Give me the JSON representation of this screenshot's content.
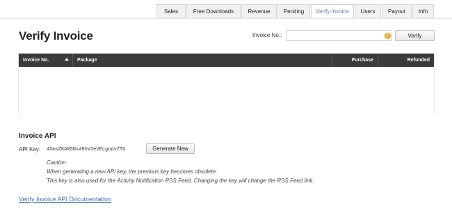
{
  "tabs": [
    {
      "label": "Sales",
      "active": false
    },
    {
      "label": "Free Downloads",
      "active": false
    },
    {
      "label": "Revenue",
      "active": false
    },
    {
      "label": "Pending",
      "active": false
    },
    {
      "label": "Verify Invoice",
      "active": true
    },
    {
      "label": "Users",
      "active": false
    },
    {
      "label": "Payout",
      "active": false
    },
    {
      "label": "Info",
      "active": false
    }
  ],
  "page": {
    "title": "Verify Invoice",
    "invoice_label": "Invoice No.:",
    "invoice_value": "",
    "info_icon": "info-icon",
    "verify_label": "Verify"
  },
  "table": {
    "columns": [
      "Invoice No.",
      "Package",
      "Purchase",
      "Refunded"
    ],
    "sort_icon": "sort-ascending-icon",
    "rows": []
  },
  "api": {
    "heading": "Invoice API",
    "key_label": "API Key:",
    "key_value": "4XmsZKANSNs49hV3eVEcgodvZTU",
    "generate_label": "Generate New",
    "caution_title": "Caution:",
    "caution_line1": "When generating a new API key, the previous key becomes obsolete.",
    "caution_line2": "This key is also used for the Activity Notification RSS Feed. Changing the key will change the RSS Feed link."
  },
  "footer": {
    "doc_link": "Verify Invoice API Documentation"
  },
  "colors": {
    "header_bg": "#3b3b3b",
    "link": "#3a6fc1",
    "active_tab_text": "#5a7fc4",
    "info_icon": "#f0a92a"
  }
}
